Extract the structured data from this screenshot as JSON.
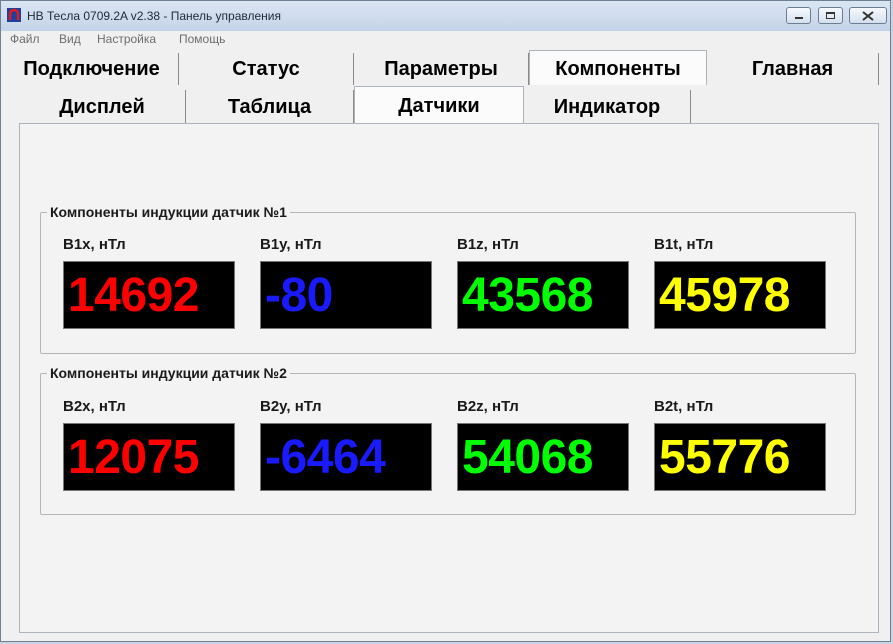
{
  "window": {
    "title": "HB Тесла 0709.2A v2.38 - Панель управления"
  },
  "menu": [
    "Файл",
    "Вид",
    "Настройка",
    "Помощь"
  ],
  "main_tabs": [
    {
      "label": "Подключение"
    },
    {
      "label": "Статус"
    },
    {
      "label": "Параметры"
    },
    {
      "label": "Компоненты",
      "active": true
    },
    {
      "label": "Главная"
    }
  ],
  "sub_tabs": [
    {
      "label": "Дисплей"
    },
    {
      "label": "Таблица"
    },
    {
      "label": "Датчики",
      "active": true
    },
    {
      "label": "Индикатор"
    }
  ],
  "colors": {
    "x": "#ff0000",
    "y": "#1a1aff",
    "z": "#00ff00",
    "t": "#ffff00",
    "lcd_bg": "#000000"
  },
  "groups": [
    {
      "title": "Компоненты индукции датчик №1",
      "readouts": [
        {
          "label": "B1x, нТл",
          "value": "14692"
        },
        {
          "label": "B1y, нТл",
          "value": "-80"
        },
        {
          "label": "B1z, нТл",
          "value": "43568"
        },
        {
          "label": "B1t, нТл",
          "value": "45978"
        }
      ]
    },
    {
      "title": "Компоненты индукции датчик №2",
      "readouts": [
        {
          "label": "B2x, нТл",
          "value": "12075"
        },
        {
          "label": "B2y, нТл",
          "value": "-6464"
        },
        {
          "label": "B2z, нТл",
          "value": "54068"
        },
        {
          "label": "B2t, нТл",
          "value": "55776"
        }
      ]
    }
  ]
}
